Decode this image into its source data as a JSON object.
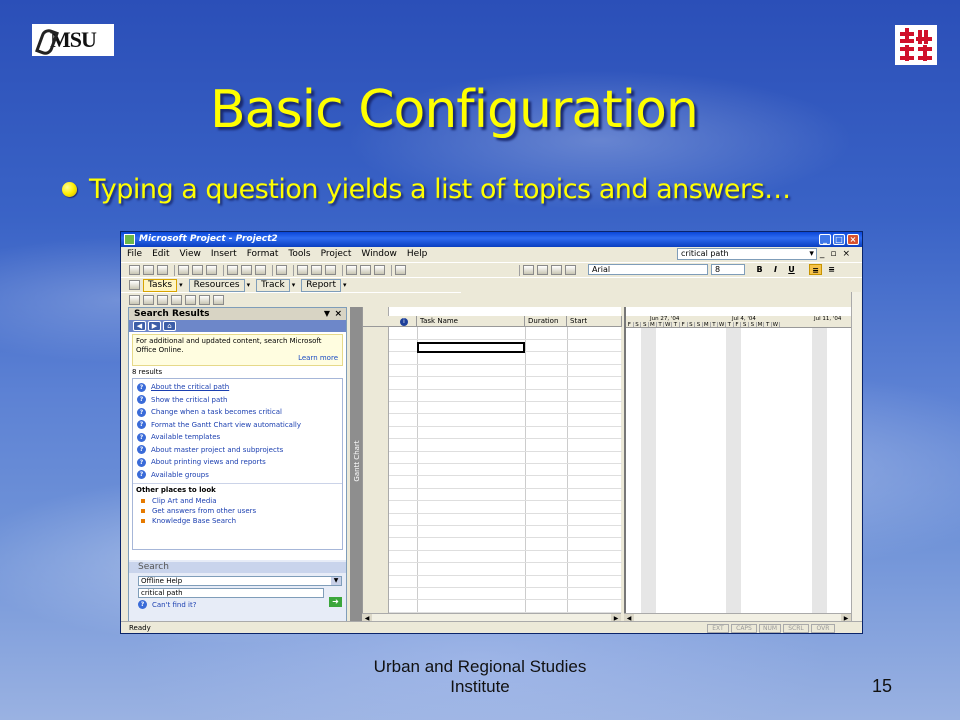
{
  "slide": {
    "title": "Basic Configuration",
    "bullet": "Typing a question yields a list of topics and answers…",
    "footer_line1": "Urban and Regional Studies",
    "footer_line2": "Institute",
    "page_number": "15",
    "logo_left_text": "MSU"
  },
  "app": {
    "window_title": "Microsoft Project - Project2",
    "menu": [
      "File",
      "Edit",
      "View",
      "Insert",
      "Format",
      "Tools",
      "Project",
      "Window",
      "Help"
    ],
    "help_query": "critical path",
    "font_name": "Arial",
    "font_size": "8",
    "fmt_bold": "B",
    "fmt_italic": "I",
    "fmt_underline": "U",
    "toolbar_tabs": [
      "Tasks",
      "Resources",
      "Track",
      "Report"
    ],
    "status": "Ready",
    "status_indicators": [
      "EXT",
      "CAPS",
      "NUM",
      "SCRL",
      "OVR"
    ]
  },
  "task_pane": {
    "title": "Search Results",
    "info_text": "For additional and updated content, search Microsoft Office Online.",
    "learn_more": "Learn more",
    "result_count": "8 results",
    "results": [
      "About the critical path",
      "Show the critical path",
      "Change when a task becomes critical",
      "Format the Gantt Chart view automatically",
      "Available templates",
      "About master project and subprojects",
      "About printing views and reports",
      "Available groups"
    ],
    "other_places_heading": "Other places to look",
    "other_places": [
      "Clip Art and Media",
      "Get answers from other users",
      "Knowledge Base Search"
    ],
    "search_heading": "Search",
    "search_scope": "Offline Help",
    "search_query": "critical path",
    "cant_find": "Can't find it?"
  },
  "grid": {
    "view_label": "Gantt Chart",
    "info_col": "i",
    "columns": [
      "Task Name",
      "Duration",
      "Start"
    ]
  },
  "gantt": {
    "weeks": [
      "Jun 27, '04",
      "Jul 4, '04",
      "Jul 11, '04"
    ],
    "days": [
      "F",
      "S",
      "S",
      "M",
      "T",
      "W",
      "T",
      "F",
      "S",
      "S",
      "M",
      "T",
      "W",
      "T",
      "F",
      "S",
      "S",
      "M",
      "T",
      "W"
    ]
  },
  "colors": {
    "title": "#ffff00",
    "titlebar": "#0a46d8",
    "link": "#1b3fb0"
  }
}
